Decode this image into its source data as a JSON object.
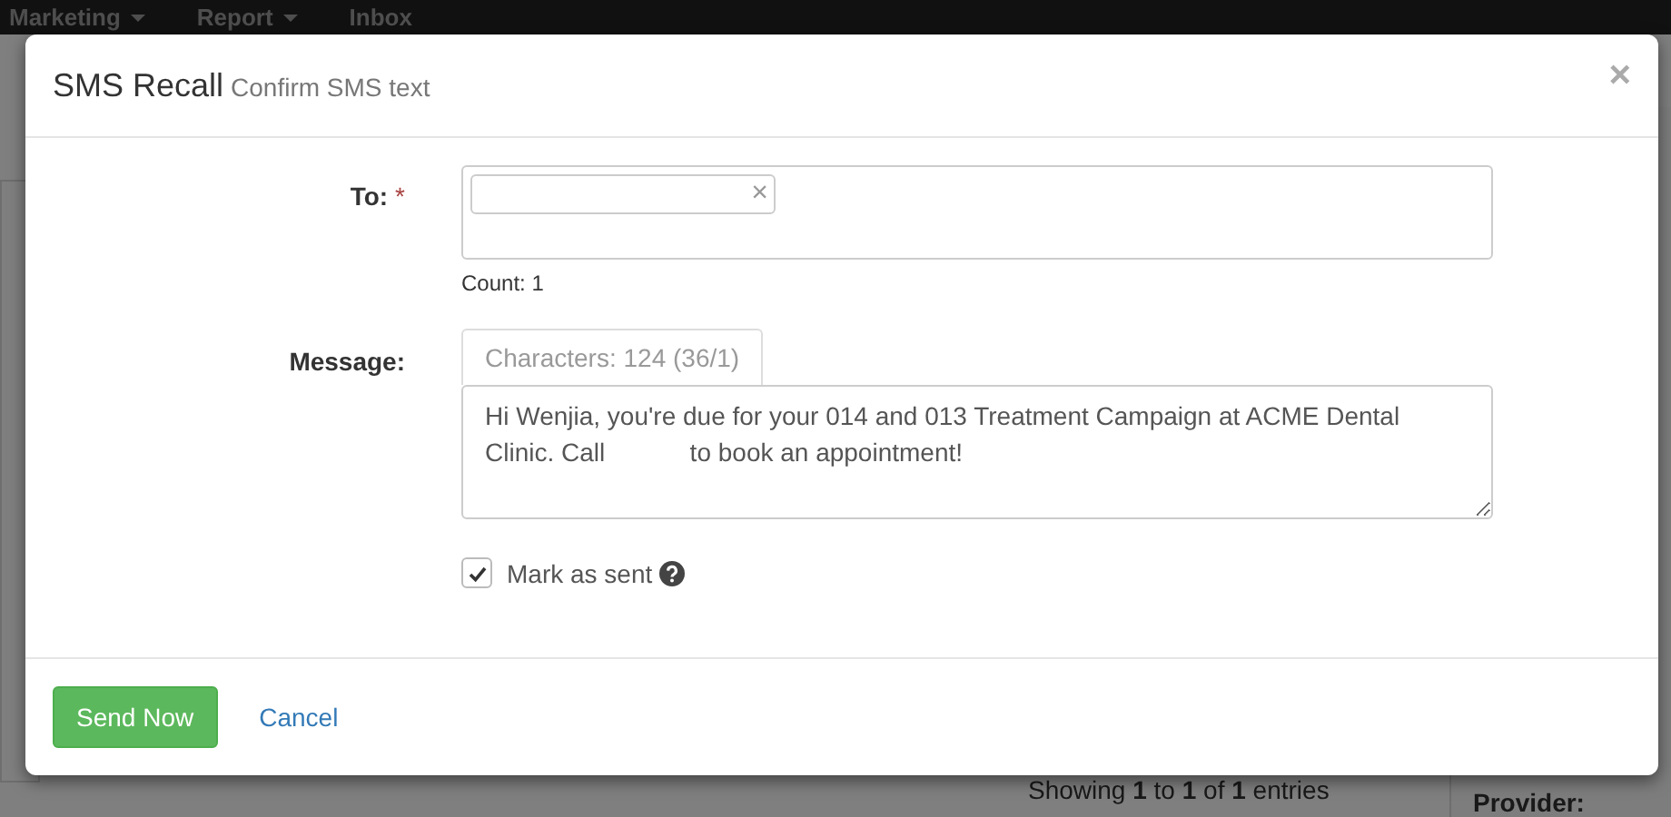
{
  "navbar": {
    "items": [
      {
        "label": "Marketing",
        "dropdown": true
      },
      {
        "label": "Report",
        "dropdown": true
      },
      {
        "label": "Inbox",
        "dropdown": false
      }
    ]
  },
  "background": {
    "entries_info": "Showing **1** to **1** of **1** entries",
    "provider_label": "Provider:"
  },
  "modal": {
    "title": "SMS Recall",
    "subtitle": "Confirm SMS text",
    "close": "×",
    "to": {
      "label": "To:",
      "required_mark": "*",
      "recipients": [
        {
          "remove": "×"
        }
      ],
      "count": "Count: 1"
    },
    "message": {
      "label": "Message:",
      "characters": "Characters: 124 (36/1)",
      "value": "Hi Wenjia, you're due for your 014 and 013 Treatment Campaign at ACME Dental Clinic. Call            to book an appointment!"
    },
    "mark_as_sent": {
      "label": "Mark as sent",
      "checked": true
    },
    "buttons": [
      {
        "label": "Send Now",
        "kind": "primary"
      },
      {
        "label": "Cancel",
        "kind": "link"
      }
    ]
  }
}
